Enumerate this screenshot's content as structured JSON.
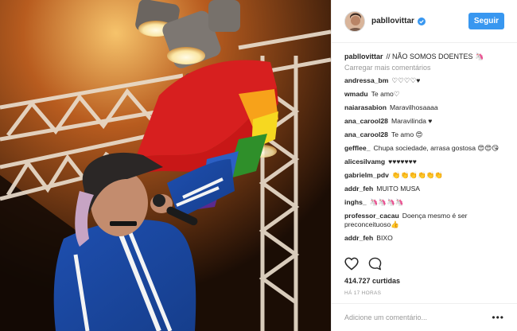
{
  "header": {
    "username": "pabllovittar",
    "follow_label": "Seguir"
  },
  "caption": {
    "username": "pabllovittar",
    "text": "// NÃO SOMOS DOENTES 🦄"
  },
  "load_more_label": "Carregar mais comentários",
  "comments": [
    {
      "user": "andressa_bm",
      "text": "♡♡♡♡♥"
    },
    {
      "user": "wmadu",
      "text": "Te amo♡"
    },
    {
      "user": "naiarasabion",
      "text": "Maravilhosaaaa"
    },
    {
      "user": "ana_carool28",
      "text": "Maravilinda ♥"
    },
    {
      "user": "ana_carool28",
      "text": "Te amo 😍"
    },
    {
      "user": "gefflee_",
      "text": "Chupa sociedade, arrasa gostosa 😍😍😘"
    },
    {
      "user": "alicesilvamg",
      "text": "♥♥♥♥♥♥♥"
    },
    {
      "user": "gabrielm_pdv",
      "text": "👏👏👏👏👏👏"
    },
    {
      "user": "addr_feh",
      "text": "MUITO MUSA"
    },
    {
      "user": "inghs_",
      "text": "🦄🦄🦄🦄"
    },
    {
      "user": "professor_cacau",
      "text": "Doença mesmo é ser preconceituoso👍"
    },
    {
      "user": "addr_feh",
      "text": "BIXO"
    }
  ],
  "likes": "414.727 curtidas",
  "timestamp": "HÁ 17 HORAS",
  "comment_placeholder": "Adicione um comentário...",
  "more_label": "•••",
  "colors": {
    "accent": "#3897f0",
    "text": "#262626",
    "muted": "#999999",
    "border": "#efefef"
  }
}
